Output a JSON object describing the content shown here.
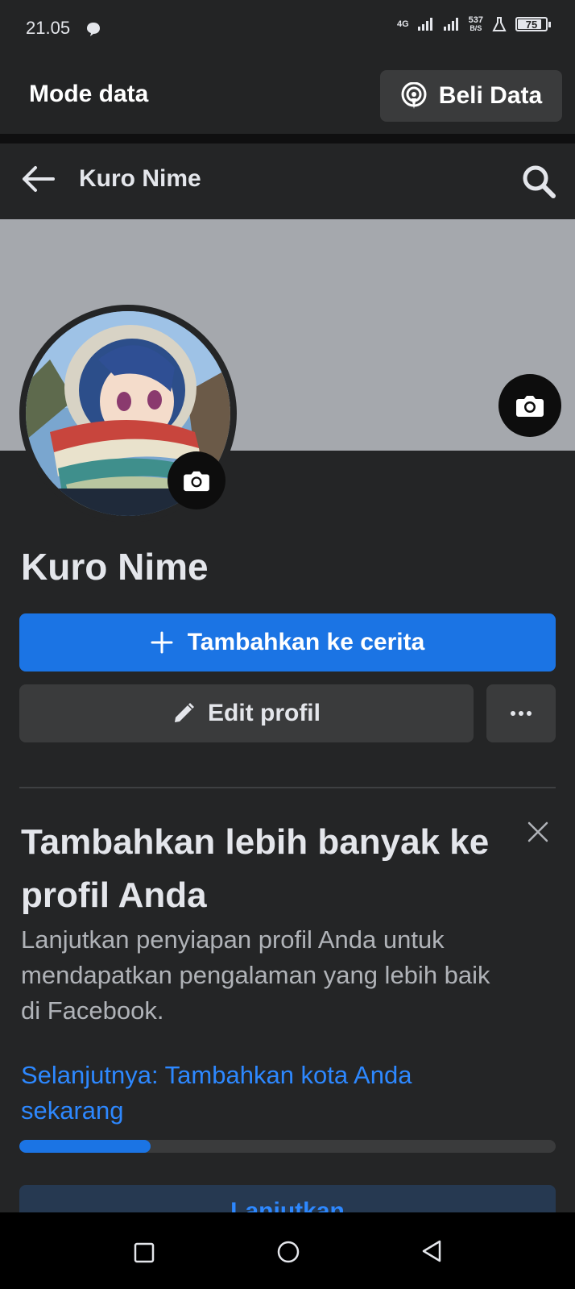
{
  "status_bar": {
    "time": "21.05",
    "network_type": "4G",
    "net_speed_value": "537",
    "net_speed_unit": "B/S",
    "battery": "75"
  },
  "data_bar": {
    "title": "Mode data",
    "buy_label": "Beli Data"
  },
  "header": {
    "title": "Kuro Nime"
  },
  "profile": {
    "name": "Kuro Nime",
    "add_story_label": "Tambahkan ke cerita",
    "edit_label": "Edit profil",
    "more_label": "···"
  },
  "card": {
    "title": "Tambahkan lebih banyak ke profil Anda",
    "description": "Lanjutkan penyiapan profil Anda untuk mendapatkan pengalaman yang lebih baik di Facebook.",
    "next_link": "Selanjutnya: Tambahkan kota Anda sekarang",
    "progress": 0.245,
    "continue_label": "Lanjutkan"
  },
  "colors": {
    "accent": "#1b74e4",
    "link": "#2d88ff",
    "background": "#242526",
    "surface": "#3a3b3c"
  }
}
